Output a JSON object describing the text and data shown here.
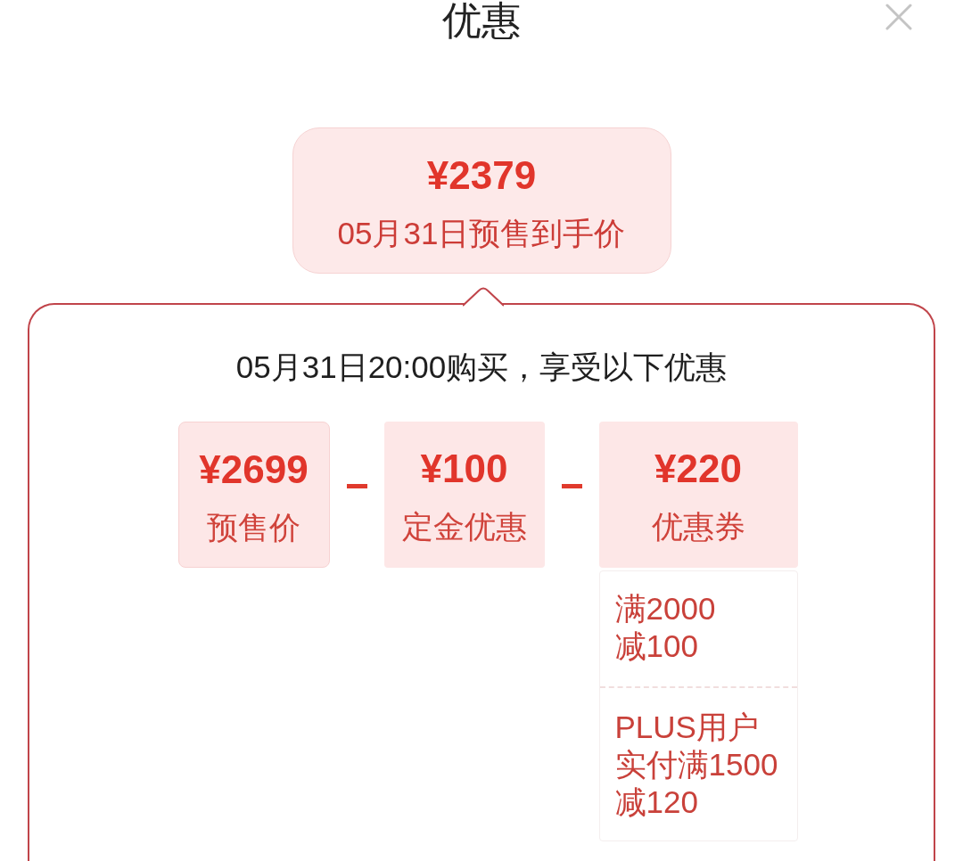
{
  "header": {
    "title": "优惠"
  },
  "price_bubble": {
    "price": "¥2379",
    "caption": "05月31日预售到手价"
  },
  "breakdown": {
    "heading": "05月31日20:00购买，享受以下优惠",
    "items": [
      {
        "kind": "base",
        "amount": "¥2699",
        "label": "预售价"
      },
      {
        "kind": "discount",
        "amount": "¥100",
        "label": "定金优惠"
      },
      {
        "kind": "discount",
        "amount": "¥220",
        "label": "优惠券",
        "coupons": [
          {
            "condition": "满2000",
            "discount": "减100"
          },
          {
            "condition": "PLUS用户实付满1500",
            "discount": "减120"
          }
        ]
      }
    ]
  }
}
